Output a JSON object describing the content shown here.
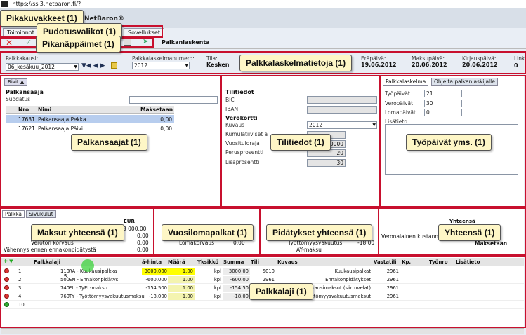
{
  "browser": {
    "url": "https://ssl3.netbaron.fi/?"
  },
  "app": {
    "brand": "NetBaron®",
    "title": "Palkanlaskenta"
  },
  "menu": {
    "items": [
      "Toiminnot",
      "Sovellukset"
    ]
  },
  "callouts": {
    "pikakuvakkeet": "Pikakuvakkeet (1)",
    "pudotusvalikot": "Pudotusvalikot (1)",
    "pikanappaimet": "Pikanäppäimet (1)",
    "palkkalaskelmatietoja": "Palkkalaskelmatietoja (1)",
    "palkansaajat": "Palkansaajat (1)",
    "tilitiedot": "Tilitiedot (1)",
    "tyopaivat": "Työpäivät yms. (1)",
    "maksut": "Maksut yhteensä (1)",
    "vuosilomapalkat": "Vuosilomapalkat (1)",
    "pidatykset": "Pidätykset yhteensä (1)",
    "yhteensa": "Yhteensä (1)",
    "palkkalaji": "Palkkalaji (1)"
  },
  "header": {
    "palkkakausi_label": "Palkkakausi:",
    "palkkakausi_value": "06_kesäkuu_2012",
    "laskelmanumero_label": "Palkkalaskelmanumero:",
    "laskelmanumero_value": "2012",
    "tila_label": "Tila:",
    "tila_value": "Kesken",
    "erapaiva_label": "Eräpäivä:",
    "erapaiva_value": "19.06.2012",
    "maksupaiva_label": "Maksupäivä:",
    "maksupaiva_value": "20.06.2012",
    "kirjauspaiva_label": "Kirjauspäivä:",
    "kirjauspaiva_value": "20.06.2012",
    "linkit_label": "Linki",
    "linkit_value": "0"
  },
  "payees": {
    "rivit_button": "Rivit",
    "title": "Palkansaaja",
    "filter_label": "Suodatus",
    "columns": [
      "Nro",
      "Nimi",
      "Maksetaan"
    ],
    "rows": [
      {
        "nro": "17631",
        "nimi": "Palkansaaja Pekka",
        "maksetaan": "0,00"
      },
      {
        "nro": "17621",
        "nimi": "Palkansaaja Päivi",
        "maksetaan": "0,00"
      }
    ]
  },
  "account": {
    "title": "Tilitiedot",
    "bic": "BIC",
    "iban": "IBAN",
    "verokortti": "Verokortti",
    "kuvaus": "Kuvaus",
    "kuvaus_value": "2012",
    "kumulatiiviset": "Kumulatiiviset a",
    "vuosituloraja": "Vuosituloraja",
    "vuosituloraja_value": "50000",
    "perusprosentti": "Perusprosentti",
    "perusprosentti_value": "20",
    "lisaprosentti": "Lisäprosentti",
    "lisaprosentti_value": "30"
  },
  "workdays": {
    "tabs": [
      "Palkkalaskelma",
      "Ohjeita palkanlaskijalle"
    ],
    "tyopaivat": "Työpäivät",
    "tyopaivat_value": "21",
    "veropaivat": "Veropäivät",
    "veropaivat_value": "30",
    "lomapaivat": "Lomapäivät",
    "lomapaivat_value": "0",
    "lisatieto": "Lisätieto"
  },
  "totals": {
    "tabs": [
      "Palkka",
      "Sivukulut"
    ],
    "eur_header": "EUR",
    "maksut_first_value": "3 000,00",
    "rows": [
      {
        "label": "",
        "value": "0,00"
      },
      {
        "label": "Veroton korvaus",
        "value": "0,00"
      },
      {
        "label": "Vähennys ennen ennakonpidätystä",
        "value": "0,00"
      }
    ],
    "loma": {
      "lomakorvaus": "Lomakorvaus",
      "lomakorvaus_value": "0,00"
    },
    "pid": {
      "tyottomyys": "Työttömyysvakuutus",
      "tyottomyys_value": "-18,00",
      "ay": "AY-maksu"
    },
    "yht": {
      "header": "Yhteensä",
      "veronalainen": "Veronalainen kustann",
      "maksetaan": "Maksetaan"
    }
  },
  "paytypes": {
    "columns": [
      "Palkkalaji",
      "á-hinta",
      "Määrä",
      "Yksikkö",
      "Summa",
      "Tili",
      "Kuvaus",
      "Vastatili",
      "Kp.",
      "Työnro",
      "Lisätieto"
    ],
    "rows": [
      {
        "n": "1",
        "code": "110",
        "name": "RA - Kuukausipalkka",
        "hinta": "3000.000",
        "maara": "1.00",
        "yks": "kpl",
        "summa": "3000.00",
        "tili": "5010",
        "kuvaus": "Kuukausipalkat",
        "vastatili": "2961"
      },
      {
        "n": "2",
        "code": "500",
        "name": "EN - Ennakonpidätys",
        "hinta": "-600.000",
        "maara": "1.00",
        "yks": "kpl",
        "summa": "-600.00",
        "tili": "2961",
        "kuvaus": "Ennakonpidätykset",
        "vastatili": "2961"
      },
      {
        "n": "3",
        "code": "740",
        "name": "EL - TyEL-maksu",
        "hinta": "-154.500",
        "maara": "1.00",
        "yks": "kpl",
        "summa": "-154.50",
        "tili": "",
        "kuvaus": "Kuukausimaksut (siirtovelat)",
        "vastatili": "2961"
      },
      {
        "n": "4",
        "code": "760",
        "name": "TY - Työttömyysvakuutusmaksu",
        "hinta": "-18.000",
        "maara": "1.00",
        "yks": "kpl",
        "summa": "-18.00",
        "tili": "",
        "kuvaus": "Työttömyysvakuutusmaksut",
        "vastatili": "2961"
      },
      {
        "n": "10",
        "code": "",
        "name": "",
        "hinta": "",
        "maara": "",
        "yks": "",
        "summa": "",
        "tili": "",
        "kuvaus": "",
        "vastatili": ""
      }
    ]
  },
  "colors": {
    "accent_red": "#c8102e",
    "callout_bg": "#fef6c6",
    "highlight_yellow": "#ffff00",
    "selection_blue": "#b7cdee"
  }
}
